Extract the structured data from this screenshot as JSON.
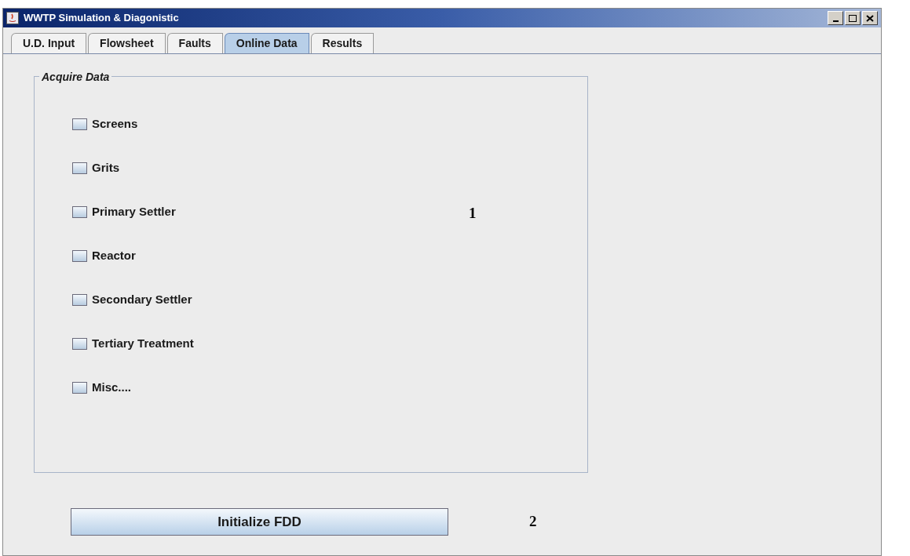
{
  "window": {
    "title": "WWTP Simulation & Diagonistic"
  },
  "tabs": [
    {
      "label": "U.D. Input",
      "selected": false
    },
    {
      "label": "Flowsheet",
      "selected": false
    },
    {
      "label": "Faults",
      "selected": false
    },
    {
      "label": "Online Data",
      "selected": true
    },
    {
      "label": "Results",
      "selected": false
    }
  ],
  "panel": {
    "title": "Acquire Data",
    "checkboxes": [
      {
        "label": "Screens",
        "checked": false
      },
      {
        "label": "Grits",
        "checked": false
      },
      {
        "label": "Primary Settler",
        "checked": false
      },
      {
        "label": "Reactor",
        "checked": false
      },
      {
        "label": "Secondary Settler",
        "checked": false
      },
      {
        "label": "Tertiary Treatment",
        "checked": false
      },
      {
        "label": "Misc....",
        "checked": false
      }
    ]
  },
  "annotations": [
    "1",
    "2"
  ],
  "button": {
    "label": "Initialize FDD"
  }
}
